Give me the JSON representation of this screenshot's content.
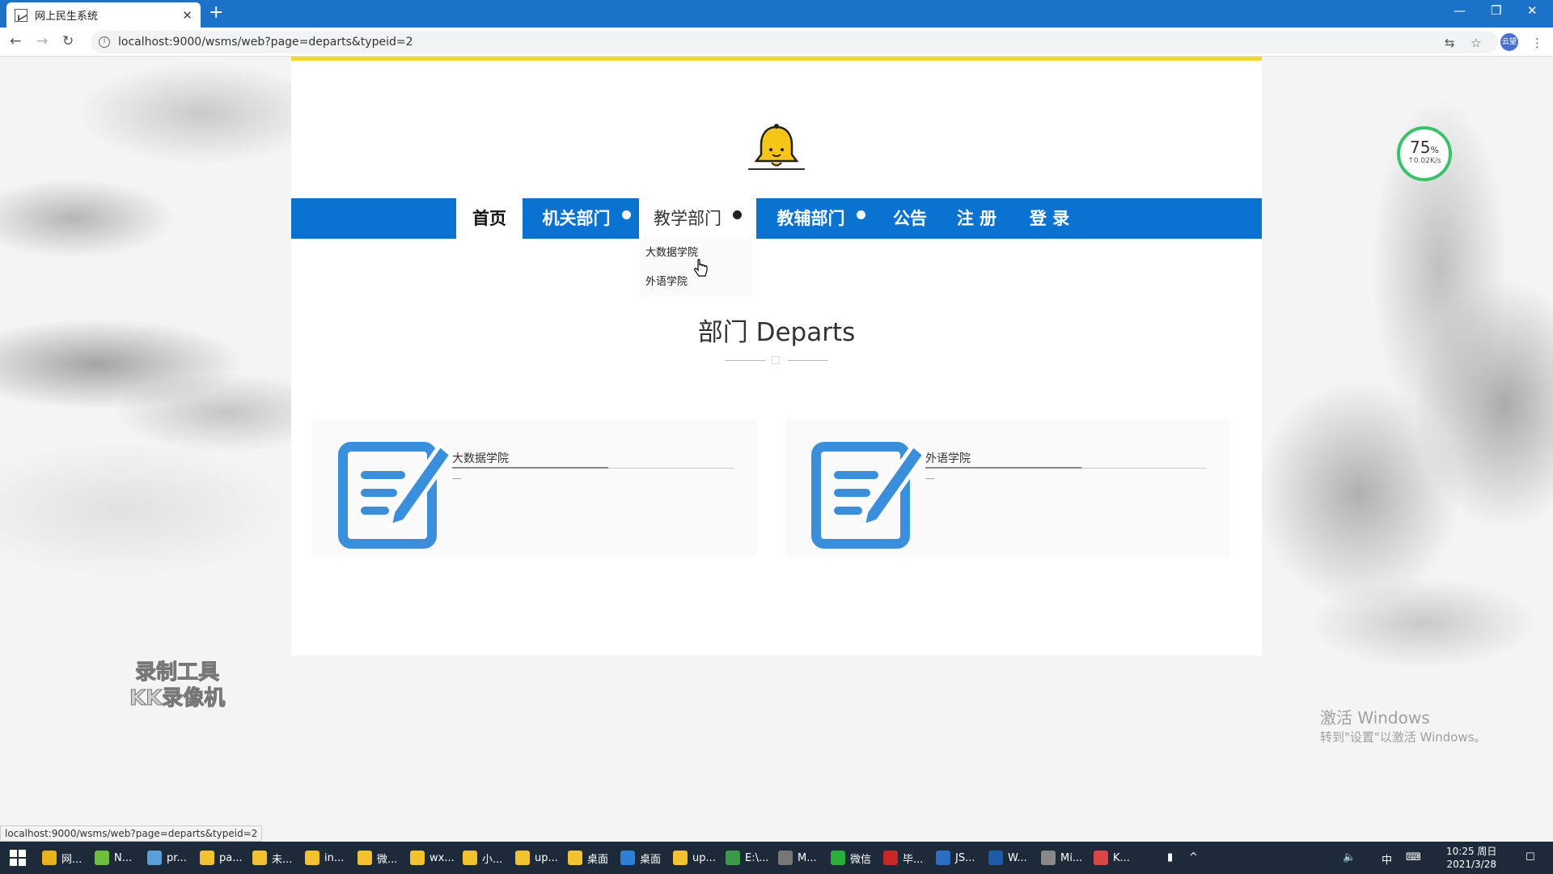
{
  "browser": {
    "tab_title": "网上民生系统",
    "address": "localhost:9000/wsms/web?page=departs&typeid=2",
    "status_url": "localhost:9000/wsms/web?page=departs&typeid=2",
    "profile": "云望"
  },
  "nav": {
    "home": "首页",
    "office": "机关部门",
    "teaching": "教学部门",
    "support": "教辅部门",
    "notice": "公告",
    "register": "注 册",
    "login": "登 录"
  },
  "dropdown": [
    "大数据学院",
    "外语学院"
  ],
  "section": {
    "title": "部门 Departs"
  },
  "departments": [
    {
      "name": "大数据学院",
      "desc": "—"
    },
    {
      "name": "外语学院",
      "desc": "—"
    }
  ],
  "speed_widget": {
    "percent": "75",
    "unit": "%",
    "rate": "↑0.02K/s"
  },
  "overlay": {
    "recorder_line1": "录制工具",
    "recorder_line2": "KK录像机",
    "activate_title": "激活 Windows",
    "activate_sub": "转到\"设置\"以激活 Windows。"
  },
  "taskbar": {
    "items": [
      "网...",
      "N...",
      "pr...",
      "pa...",
      "未...",
      "in...",
      "微...",
      "wx...",
      "小...",
      "up...",
      "桌面",
      "桌面",
      "up...",
      "E:\\...",
      "M...",
      "微信",
      "毕...",
      "JS...",
      "W...",
      "Mi...",
      "K..."
    ],
    "ime": "中",
    "time": "10:25 周日",
    "date": "2021/3/28"
  },
  "colors": {
    "nav_blue": "#0a73d2",
    "accent_yellow": "#f5d91c",
    "icon_blue": "#3a8fdd"
  }
}
